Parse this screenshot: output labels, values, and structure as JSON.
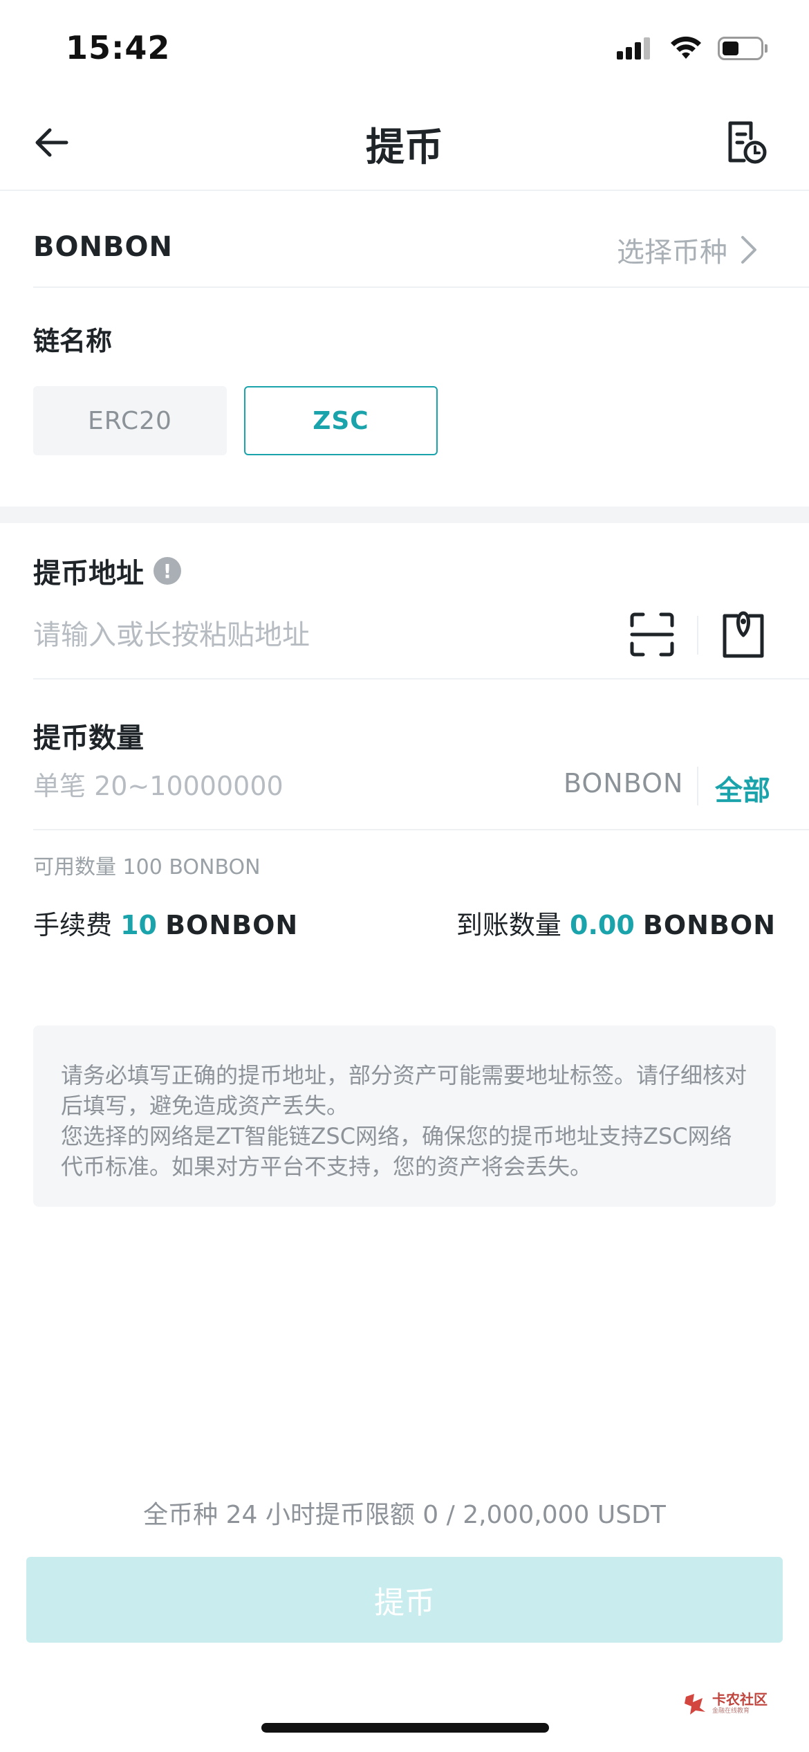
{
  "status_bar": {
    "time": "15:42",
    "icons": [
      "signal-icon",
      "wifi-icon",
      "battery-icon"
    ],
    "battery_level": 0.45
  },
  "nav": {
    "title": "提币",
    "back_icon": "arrow-left-icon",
    "record_icon": "history-record-icon"
  },
  "coin": {
    "name": "BONBON",
    "select_label": "选择币种",
    "select_icon": "chevron-right-icon"
  },
  "chain": {
    "label": "链名称",
    "options": [
      {
        "label": "ERC20",
        "selected": false
      },
      {
        "label": "ZSC",
        "selected": true
      }
    ]
  },
  "address": {
    "label": "提币地址",
    "info_icon": "info-icon",
    "info_glyph": "!",
    "placeholder": "请输入或长按粘贴地址",
    "scan_icon": "scan-icon",
    "address_book_icon": "address-book-icon"
  },
  "quantity": {
    "label": "提币数量",
    "placeholder": "单笔 20~10000000",
    "unit": "BONBON",
    "all_label": "全部",
    "available": "可用数量 100 BONBON"
  },
  "fee": {
    "label": "手续费",
    "value": "10",
    "unit": "BONBON"
  },
  "receive": {
    "label": "到账数量",
    "value": "0.00",
    "unit": "BONBON"
  },
  "notice": {
    "line1": "请务必填写正确的提币地址，部分资产可能需要地址标签。请仔细核对后填写，避免造成资产丢失。",
    "line2": "您选择的网络是ZT智能链ZSC网络，确保您的提币地址支持ZSC网络代币标准。如果对方平台不支持，您的资产将会丢失。"
  },
  "limit_text": "全币种 24 小时提币限额 0 / 2,000,000 USDT",
  "submit_label": "提币",
  "watermark": {
    "main": "卡农社区",
    "sub": "金融在线教育"
  },
  "colors": {
    "accent": "#1aa3ab",
    "button_disabled": "#c9ecee",
    "muted_text": "#8d9399",
    "section_bg": "#f2f4f6"
  }
}
